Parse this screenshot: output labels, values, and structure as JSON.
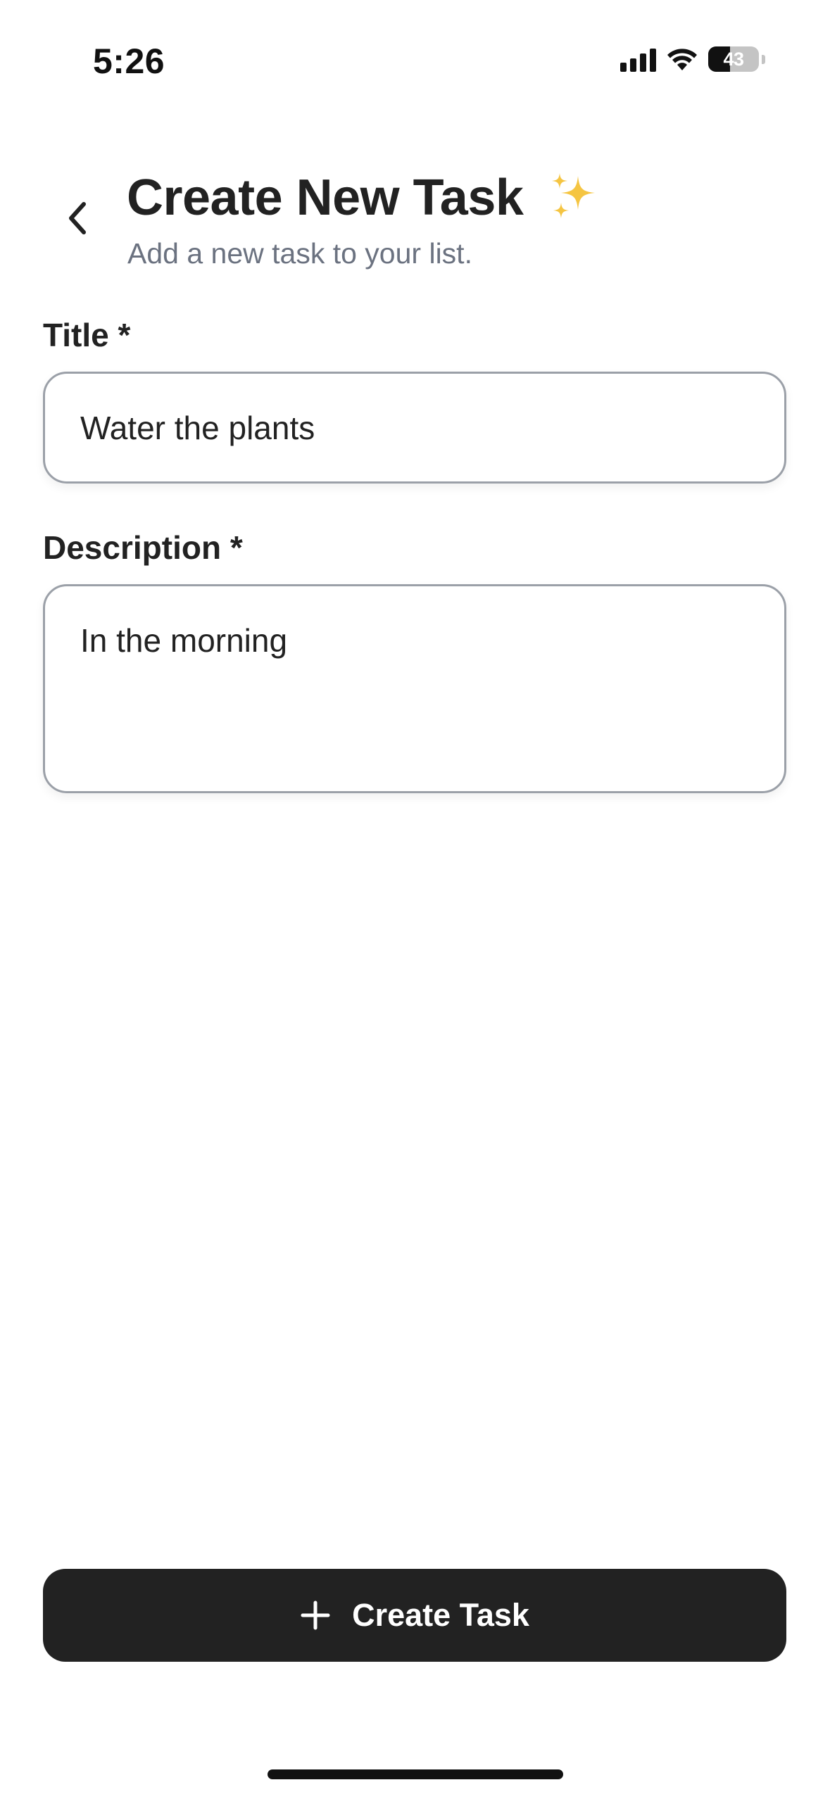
{
  "status_bar": {
    "time": "5:26",
    "battery_level": "43",
    "battery_fraction": 0.43,
    "icons": [
      "cellular-signal-icon",
      "wifi-icon",
      "battery-icon"
    ]
  },
  "header": {
    "back_icon": "chevron-left-icon",
    "title": "Create New Task",
    "title_emoji_icon": "sparkles-icon",
    "subtitle": "Add a new task to your list."
  },
  "form": {
    "title_label": "Title *",
    "title_value": "Water the plants",
    "description_label": "Description *",
    "description_value": "In the morning"
  },
  "actions": {
    "create_icon": "plus-icon",
    "create_label": "Create Task"
  },
  "colors": {
    "primary_button": "#222222",
    "subtitle_text": "#6b7280",
    "input_border": "#9ba0a8",
    "sparkle": "#f5c542"
  }
}
